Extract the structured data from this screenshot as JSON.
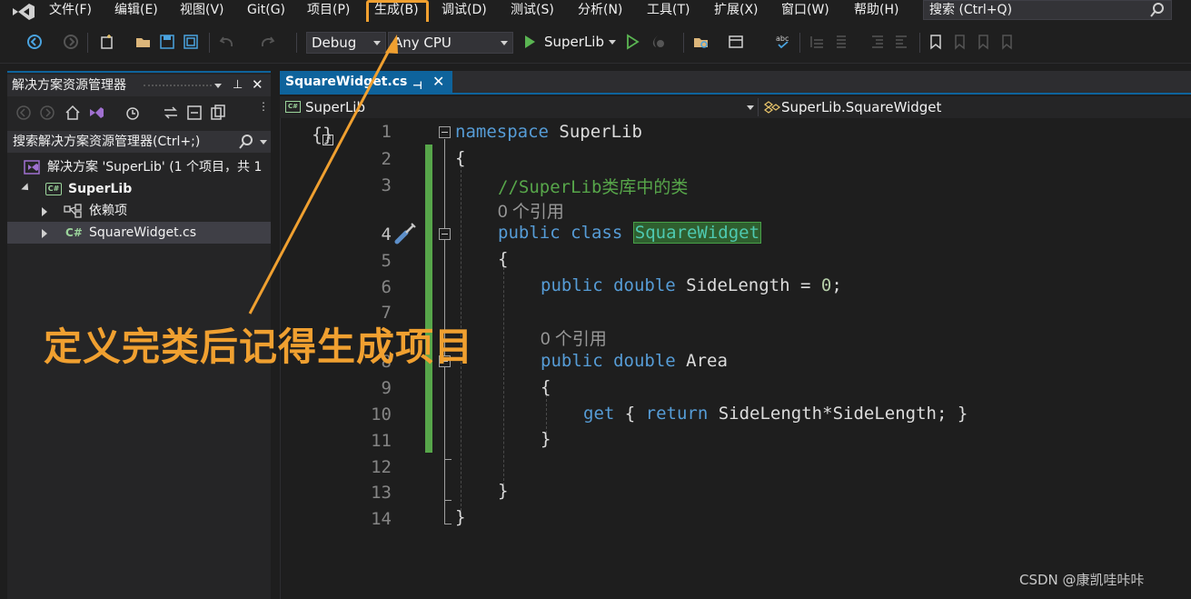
{
  "menu": {
    "items": [
      "文件(F)",
      "编辑(E)",
      "视图(V)",
      "Git(G)",
      "项目(P)",
      "生成(B)",
      "调试(D)",
      "测试(S)",
      "分析(N)",
      "工具(T)",
      "扩展(X)",
      "窗口(W)",
      "帮助(H)"
    ],
    "search_placeholder": "搜索 (Ctrl+Q)"
  },
  "toolbar": {
    "config": "Debug",
    "platform": "Any CPU",
    "run_target": "SuperLib"
  },
  "solution_explorer": {
    "title": "解决方案资源管理器",
    "search_placeholder": "搜索解决方案资源管理器(Ctrl+;)",
    "solution_label": "解决方案 'SuperLib' (1 个项目，共 1",
    "project": "SuperLib",
    "dependencies": "依赖项",
    "file": "SquareWidget.cs"
  },
  "editor": {
    "tab": "SquareWidget.cs",
    "nav_left": "SuperLib",
    "nav_right": "SuperLib.SquareWidget",
    "line_numbers": [
      "1",
      "2",
      "3",
      "4",
      "5",
      "6",
      "7",
      "8",
      "9",
      "10",
      "11",
      "12",
      "13",
      "14"
    ],
    "codelens": "0 个引用",
    "code": {
      "ns_kw": "namespace",
      "ns_name": " SuperLib",
      "open_brace": "{",
      "comment": "//SuperLib类库中的类",
      "public": "public",
      "class": "class",
      "class_name": "SquareWidget",
      "double": "double",
      "side_length": " SideLength = ",
      "zero": "0",
      "semi": ";",
      "area": " Area",
      "get": "get",
      "return": "return",
      "get_open": " { ",
      "get_expr": " SideLength*SideLength; }",
      "close_brace": "}"
    }
  },
  "annotation": "定义完类后记得生成项目",
  "watermark": "CSDN @康凯哇咔咔",
  "colors": {
    "highlight": "#f0a030",
    "keyword": "#569cd6",
    "comment": "#57a64a",
    "accent": "#0e639c"
  }
}
